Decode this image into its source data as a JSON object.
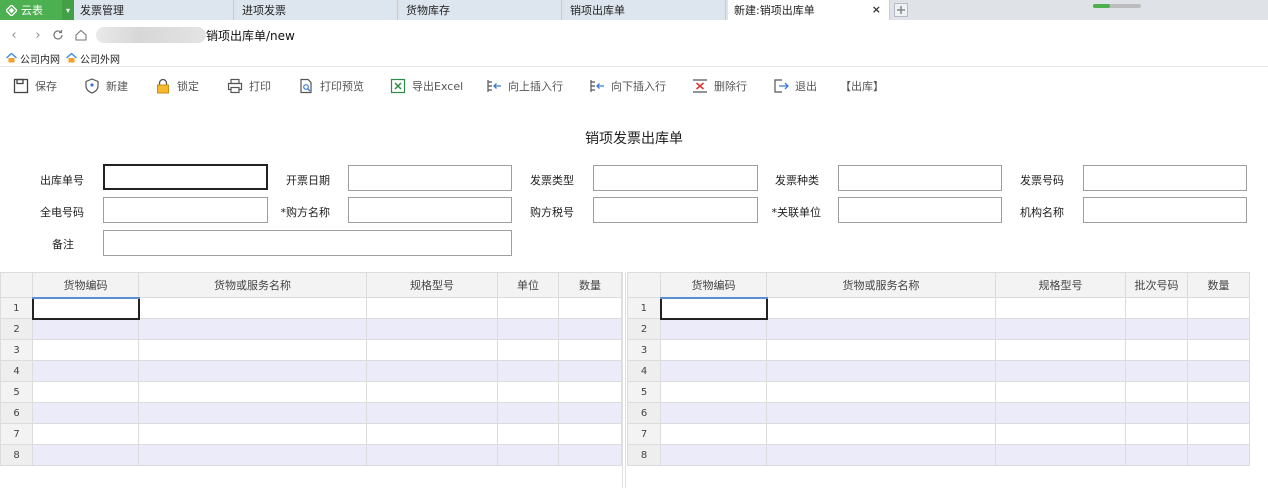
{
  "browser": {
    "app_name": "云表",
    "tabs": [
      {
        "label": "发票管理"
      },
      {
        "label": "进项发票"
      },
      {
        "label": "货物库存"
      },
      {
        "label": "销项出库单"
      },
      {
        "label": "新建:销项出库单",
        "close": "×"
      }
    ],
    "url_text": "销项出库单/new",
    "loading_progress": 0.35,
    "bookmarks": [
      {
        "label": "公司内网"
      },
      {
        "label": "公司外网"
      }
    ]
  },
  "toolbar": {
    "save": "保存",
    "new": "新建",
    "lock": "锁定",
    "print": "打印",
    "print_preview": "打印预览",
    "export_excel": "导出Excel",
    "insert_above": "向上插入行",
    "insert_below": "向下插入行",
    "delete_row": "删除行",
    "exit": "退出",
    "mode": "【出库】"
  },
  "form": {
    "title": "销项发票出库单",
    "fields": {
      "out_no": {
        "label": "出库单号",
        "value": ""
      },
      "invoice_date": {
        "label": "开票日期",
        "value": ""
      },
      "invoice_type": {
        "label": "发票类型",
        "value": ""
      },
      "invoice_kind": {
        "label": "发票种类",
        "value": ""
      },
      "invoice_number": {
        "label": "发票号码",
        "value": ""
      },
      "full_e_number": {
        "label": "全电号码",
        "value": ""
      },
      "buyer_name": {
        "label": "*购方名称",
        "value": ""
      },
      "buyer_tax_id": {
        "label": "购方税号",
        "value": ""
      },
      "related_unit": {
        "label": "*关联单位",
        "value": ""
      },
      "org_name": {
        "label": "机构名称",
        "value": ""
      },
      "remark": {
        "label": "备注",
        "value": ""
      }
    }
  },
  "grid_left": {
    "columns": [
      "货物编码",
      "货物或服务名称",
      "规格型号",
      "单位",
      "数量"
    ],
    "row_numbers": [
      "1",
      "2",
      "3",
      "4",
      "5",
      "6",
      "7",
      "8"
    ]
  },
  "grid_right": {
    "columns": [
      "货物编码",
      "货物或服务名称",
      "规格型号",
      "批次号码",
      "数量"
    ],
    "row_numbers": [
      "1",
      "2",
      "3",
      "4",
      "5",
      "6",
      "7",
      "8"
    ]
  },
  "colors": {
    "accent_green": "#4caf50",
    "tab_bg": "#dde6ee",
    "alt_row": "#ebebf9",
    "header_select": "#5b8fd4"
  }
}
